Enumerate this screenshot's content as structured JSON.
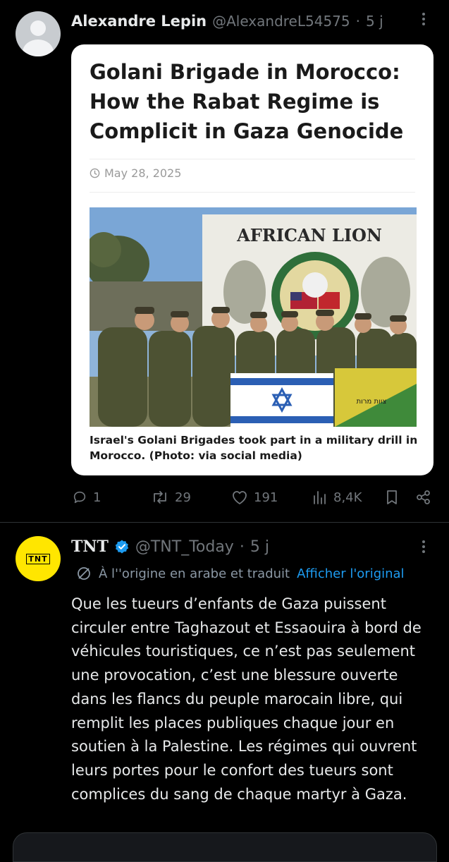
{
  "tweet1": {
    "author_name": "Alexandre Lepin",
    "handle": "@AlexandreL54575",
    "time": "5 j",
    "card": {
      "title": "Golani Brigade in Morocco: How the Rabat Regime is Complicit in Gaza Genocide",
      "date": "May 28, 2025",
      "banner_text": "AFRICAN LION",
      "flag_text": "צוות מרות",
      "caption": "Israel's Golani Brigades took part in a military drill in Morocco. (Photo: via social media)"
    },
    "actions": {
      "replies": "1",
      "reposts": "29",
      "likes": "191",
      "views": "8,4K"
    }
  },
  "tweet2": {
    "avatar_text": "TNT",
    "author_name": "TNT",
    "handle": "@TNT_Today",
    "time": "5 j",
    "translated_note": "À l''origine en arabe et traduit",
    "show_original": "Afficher l'original",
    "body": "Que les tueurs d’enfants de Gaza puissent circuler entre Taghazout et Essaouira à bord de véhicules touristiques, ce n’est pas seulement une provocation, c’est une blessure ouverte dans les flancs du peuple marocain libre, qui remplit les places publiques chaque jour en soutien à la Palestine. Les régimes qui ouvrent leurs portes pour le confort des tueurs sont complices du sang de chaque martyr à Gaza."
  },
  "colors": {
    "background": "#000000",
    "muted": "#71767b",
    "link": "#1d9bf0",
    "verified": "#1d9bf0",
    "tnt_yellow": "#ffe600"
  }
}
